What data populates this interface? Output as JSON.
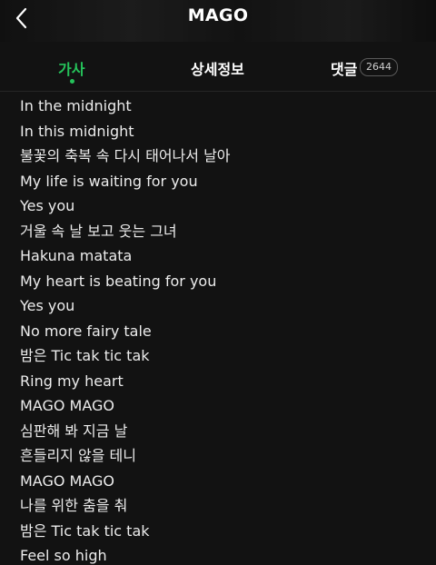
{
  "header": {
    "title": "MAGO",
    "back_icon": "chevron-left-icon"
  },
  "tabs": [
    {
      "label": "가사",
      "active": true
    },
    {
      "label": "상세정보",
      "active": false
    },
    {
      "label": "댓글",
      "active": false,
      "count": "2644"
    }
  ],
  "colors": {
    "accent": "#25c25a",
    "background": "#121212",
    "text": "#ececec"
  },
  "lyrics": [
    "In the midnight",
    "In this midnight",
    "불꽃의 축복 속 다시 태어나서 날아",
    "My life is waiting for you",
    "Yes you",
    "거울 속 날 보고 웃는 그녀",
    "Hakuna matata",
    "My heart is beating for you",
    "Yes you",
    "No more fairy tale",
    "밤은 Tic tak tic tak",
    "Ring my heart",
    "MAGO MAGO",
    "심판해 봐 지금 날",
    "흔들리지 않을 테니",
    "MAGO MAGO",
    "나를 위한 춤을 춰",
    "밤은 Tic tak tic tak",
    "Feel so high"
  ]
}
